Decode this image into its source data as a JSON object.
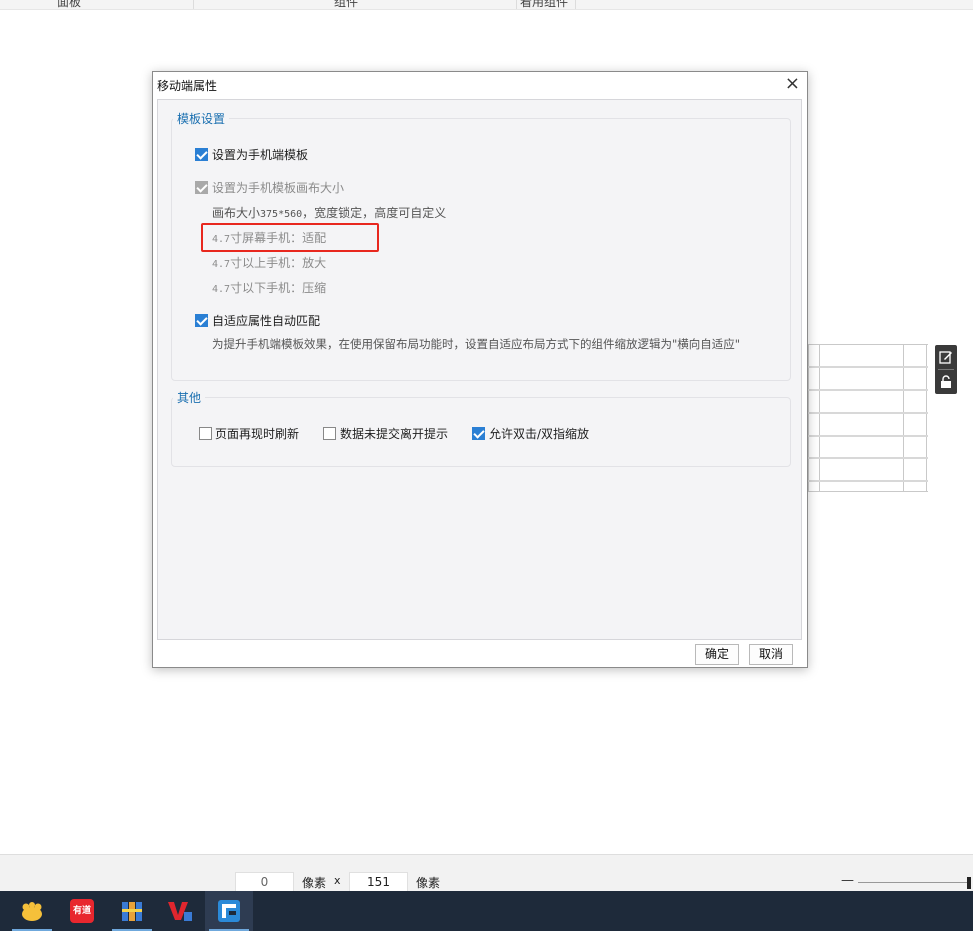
{
  "header": {
    "col1": "面板",
    "col2": "组件",
    "col3": "看用组件"
  },
  "dialog": {
    "title": "移动端属性",
    "close_symbol": "×",
    "template_group": {
      "title": "模板设置",
      "set_mobile_template": {
        "label": "设置为手机端模板",
        "checked": true
      },
      "set_canvas_size": {
        "label": "设置为手机模板画布大小",
        "checked": true,
        "disabled": true
      },
      "canvas_size_prefix": "画布大小",
      "canvas_size_value": "375*560",
      "canvas_size_width_locked": "，宽度锁定，",
      "canvas_size_suffix": "高度可自定义",
      "rule_47_prefix": "4.7",
      "rule_47_text": "寸屏幕手机：适配",
      "rule_above_prefix": "4.7",
      "rule_above_text": "寸以上手机：放大",
      "rule_below_prefix": "4.7",
      "rule_below_text": "寸以下手机：压缩",
      "auto_match": {
        "label": "自适应属性自动匹配",
        "checked": true
      },
      "auto_match_desc": "为提升手机端模板效果，在使用保留布局功能时，设置自适应布局方式下的组件缩放逻辑为\"横向自适应\""
    },
    "other_group": {
      "title": "其他",
      "refresh_on_show": {
        "label": "页面再现时刷新",
        "checked": false
      },
      "unsubmitted_prompt": {
        "label": "数据未提交离开提示",
        "checked": false
      },
      "allow_zoom": {
        "label": "允许双击/双指缩放",
        "checked": true
      }
    },
    "ok_label": "确定",
    "cancel_label": "取消"
  },
  "status_bar": {
    "x_value": "0",
    "x_unit": "像素",
    "separator": "x",
    "y_value": "151",
    "y_unit": "像素",
    "zoom_minus": "—"
  },
  "side_tools": {
    "edit_icon": "edit-icon",
    "lock_icon": "unlock-icon"
  },
  "taskbar": {
    "apps": [
      "app-yellow",
      "app-youdao",
      "app-archive",
      "app-wps",
      "app-finereport"
    ],
    "youdao_label": "有道"
  },
  "colors": {
    "accent_blue": "#2a7fd4",
    "group_title": "#1a6fb0",
    "highlight_red": "#e8271e",
    "taskbar": "#1e2a3a"
  }
}
